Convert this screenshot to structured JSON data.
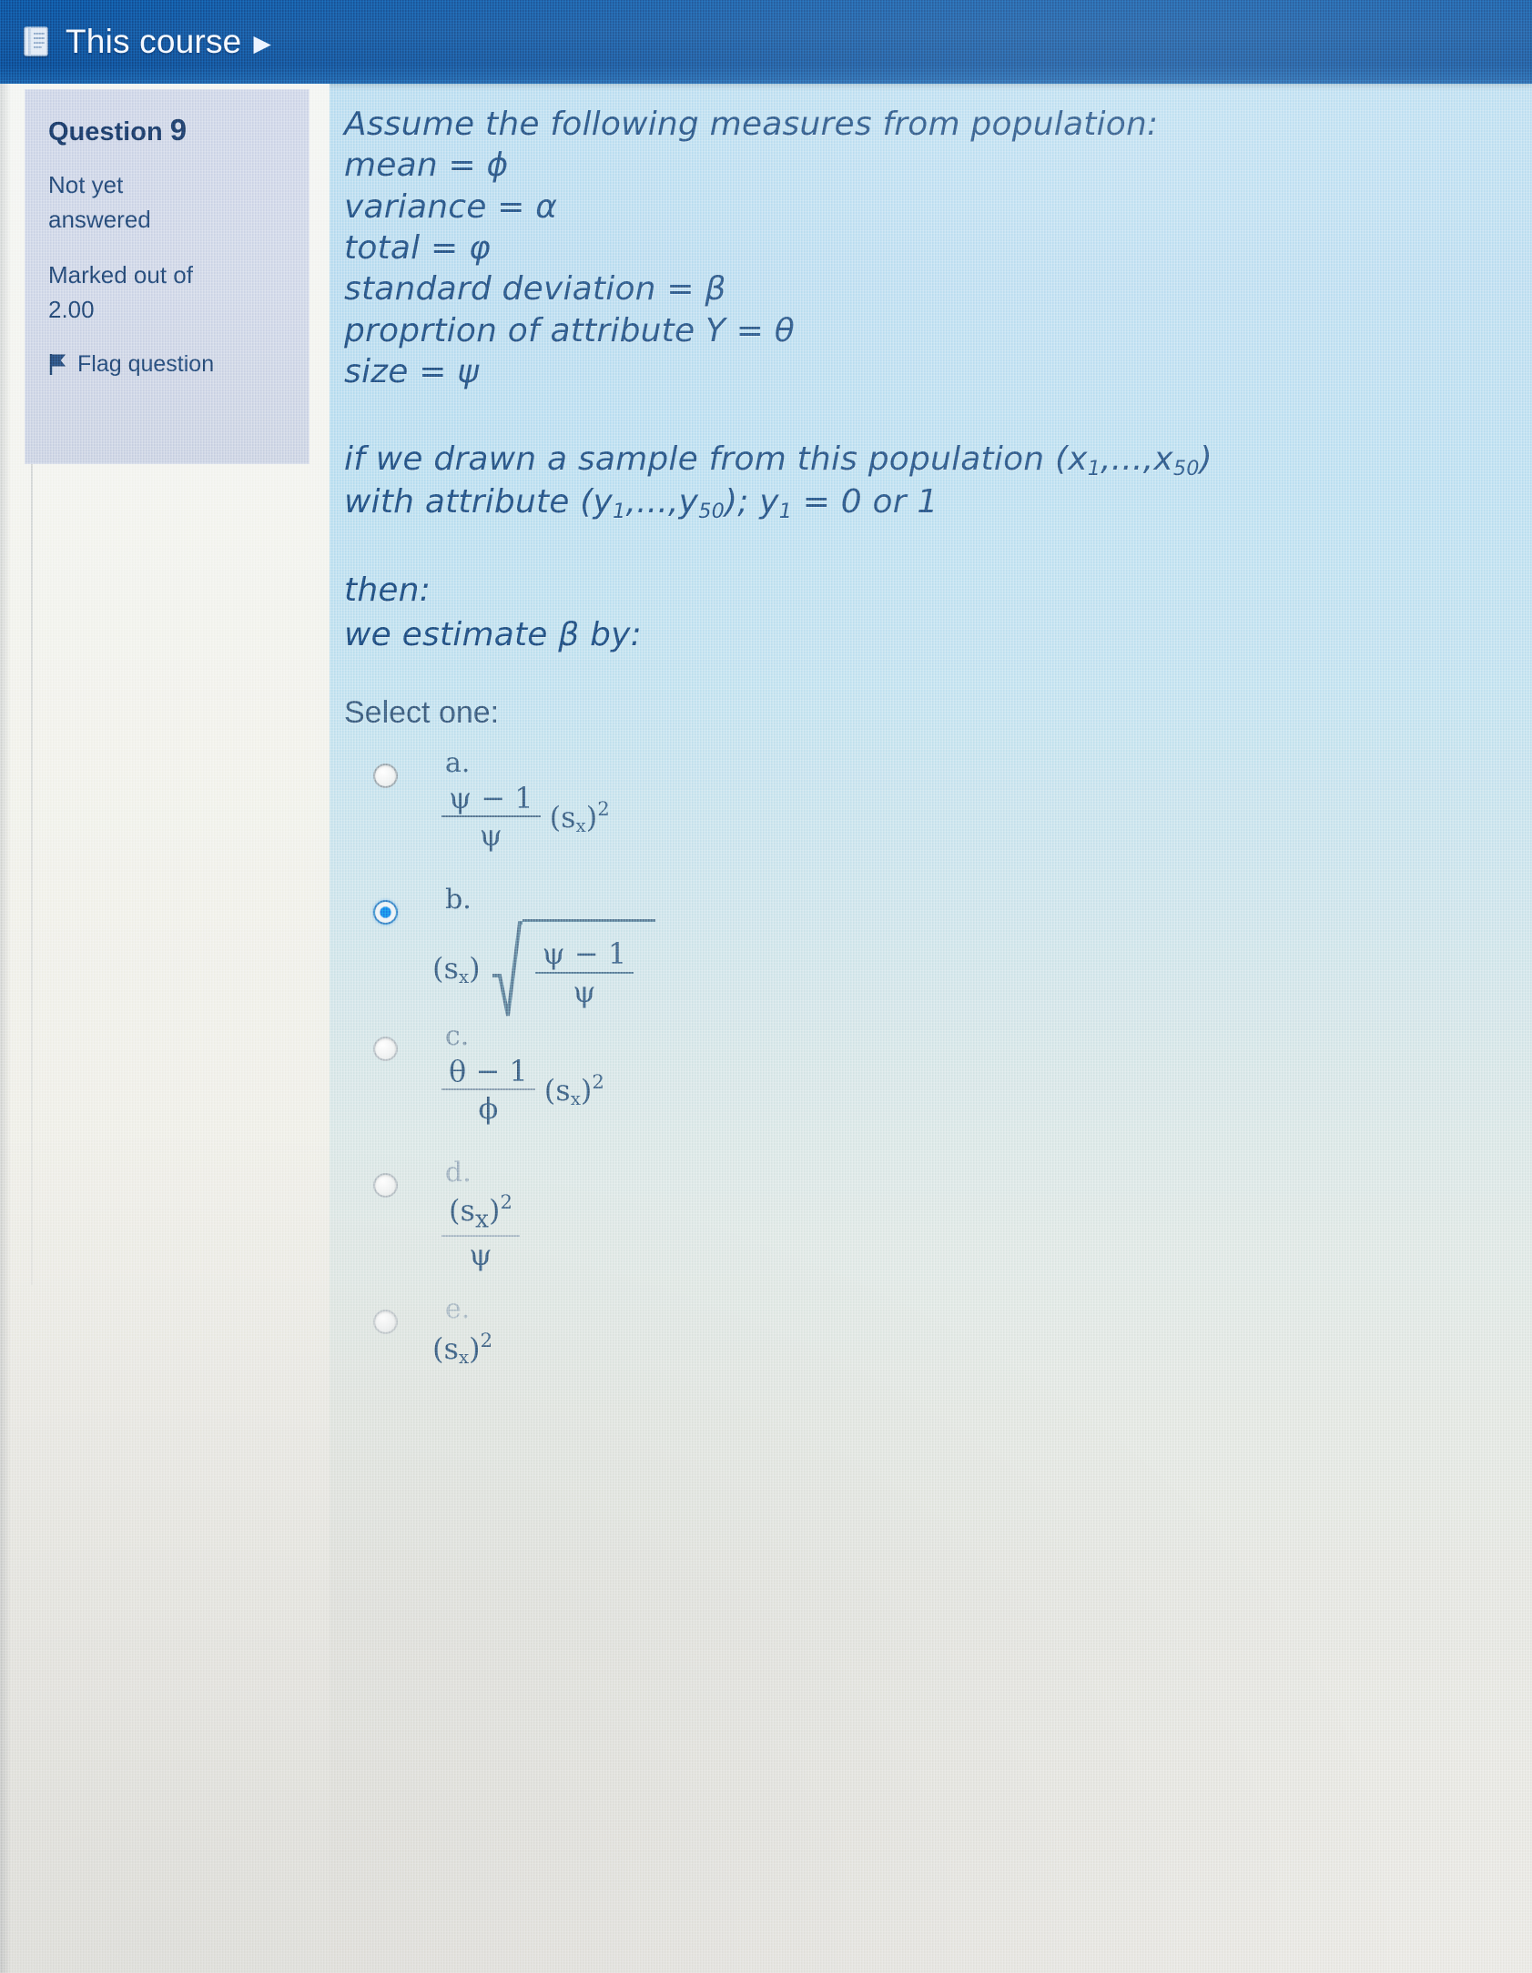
{
  "topbar": {
    "icon": "book-icon",
    "label": "This course",
    "caret": "▶"
  },
  "question_info": {
    "heading_prefix": "Question",
    "heading_number": "9",
    "state": "Not yet answered",
    "marks": "Marked out of 2.00",
    "flag_icon": "flag-icon",
    "flag_label": "Flag question"
  },
  "question": {
    "lines": [
      "Assume the following measures from population:",
      "mean = ϕ",
      "variance = α",
      "total = φ",
      "standard deviation = β",
      "proprtion of attribute Y = θ",
      "size = ψ"
    ],
    "sample_line_1_prefix": "if we drawn a sample from this population  (x",
    "sample_line_1_sub1": "1",
    "sample_line_1_mid": ",...,x",
    "sample_line_1_sub2": "50",
    "sample_line_1_suffix": ")",
    "sample_line_2_prefix": "with attribute (y",
    "sample_line_2_sub1": "1",
    "sample_line_2_mid": ",...,y",
    "sample_line_2_sub2": "50",
    "sample_line_2_mid2": "); y",
    "sample_line_2_sub3": "1",
    "sample_line_2_suffix": " = 0 or 1",
    "then_line": "then:",
    "estimate_line": "we estimate β by:"
  },
  "answers": {
    "select_one_label": "Select one:",
    "selected": "b",
    "options": [
      {
        "id": "a",
        "letter": "a.",
        "checked": false,
        "form": "fraction-times-square",
        "numerator": "ψ − 1",
        "denominator": "ψ",
        "factor_base": "s",
        "factor_sub": "x",
        "factor_exp": "2"
      },
      {
        "id": "b",
        "letter": "b.",
        "checked": true,
        "form": "factor-times-sqrt-fraction",
        "factor_base": "s",
        "factor_sub": "x",
        "numerator": "ψ − 1",
        "denominator": "ψ"
      },
      {
        "id": "c",
        "letter": "c.",
        "checked": false,
        "form": "fraction-times-square",
        "numerator": "θ − 1",
        "denominator": "ϕ",
        "factor_base": "s",
        "factor_sub": "x",
        "factor_exp": "2"
      },
      {
        "id": "d",
        "letter": "d.",
        "checked": false,
        "form": "square-over-denominator",
        "numerator_base": "s",
        "numerator_sub": "x",
        "numerator_exp": "2",
        "denominator": "ψ"
      },
      {
        "id": "e",
        "letter": "e.",
        "checked": false,
        "form": "square-only",
        "base": "s",
        "sub": "x",
        "exp": "2"
      }
    ]
  },
  "colors": {
    "topbar_blue": "#0f4f97",
    "question_text": "#204a78",
    "sidebar_box": "#ccd4e6",
    "radio_selected": "#1a84e8"
  }
}
